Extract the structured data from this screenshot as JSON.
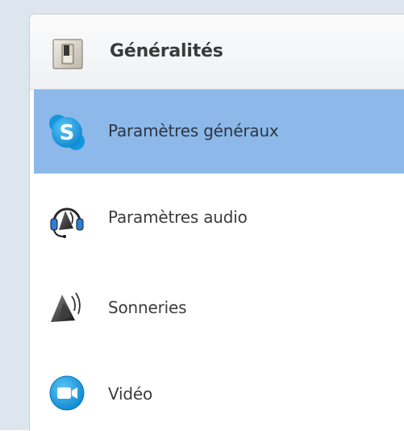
{
  "section": {
    "title": "Généralités",
    "icon": "light-switch-icon"
  },
  "items": [
    {
      "label": "Paramètres généraux",
      "icon": "skype-icon",
      "selected": true
    },
    {
      "label": "Paramètres audio",
      "icon": "headset-speaker-icon",
      "selected": false
    },
    {
      "label": "Sonneries",
      "icon": "speaker-icon",
      "selected": false
    },
    {
      "label": "Vidéo",
      "icon": "video-camera-icon",
      "selected": false
    }
  ],
  "colors": {
    "selected_background": "#8cb8ea",
    "skype_blue": "#1ea0e6",
    "outer_background": "#dde5ee"
  }
}
